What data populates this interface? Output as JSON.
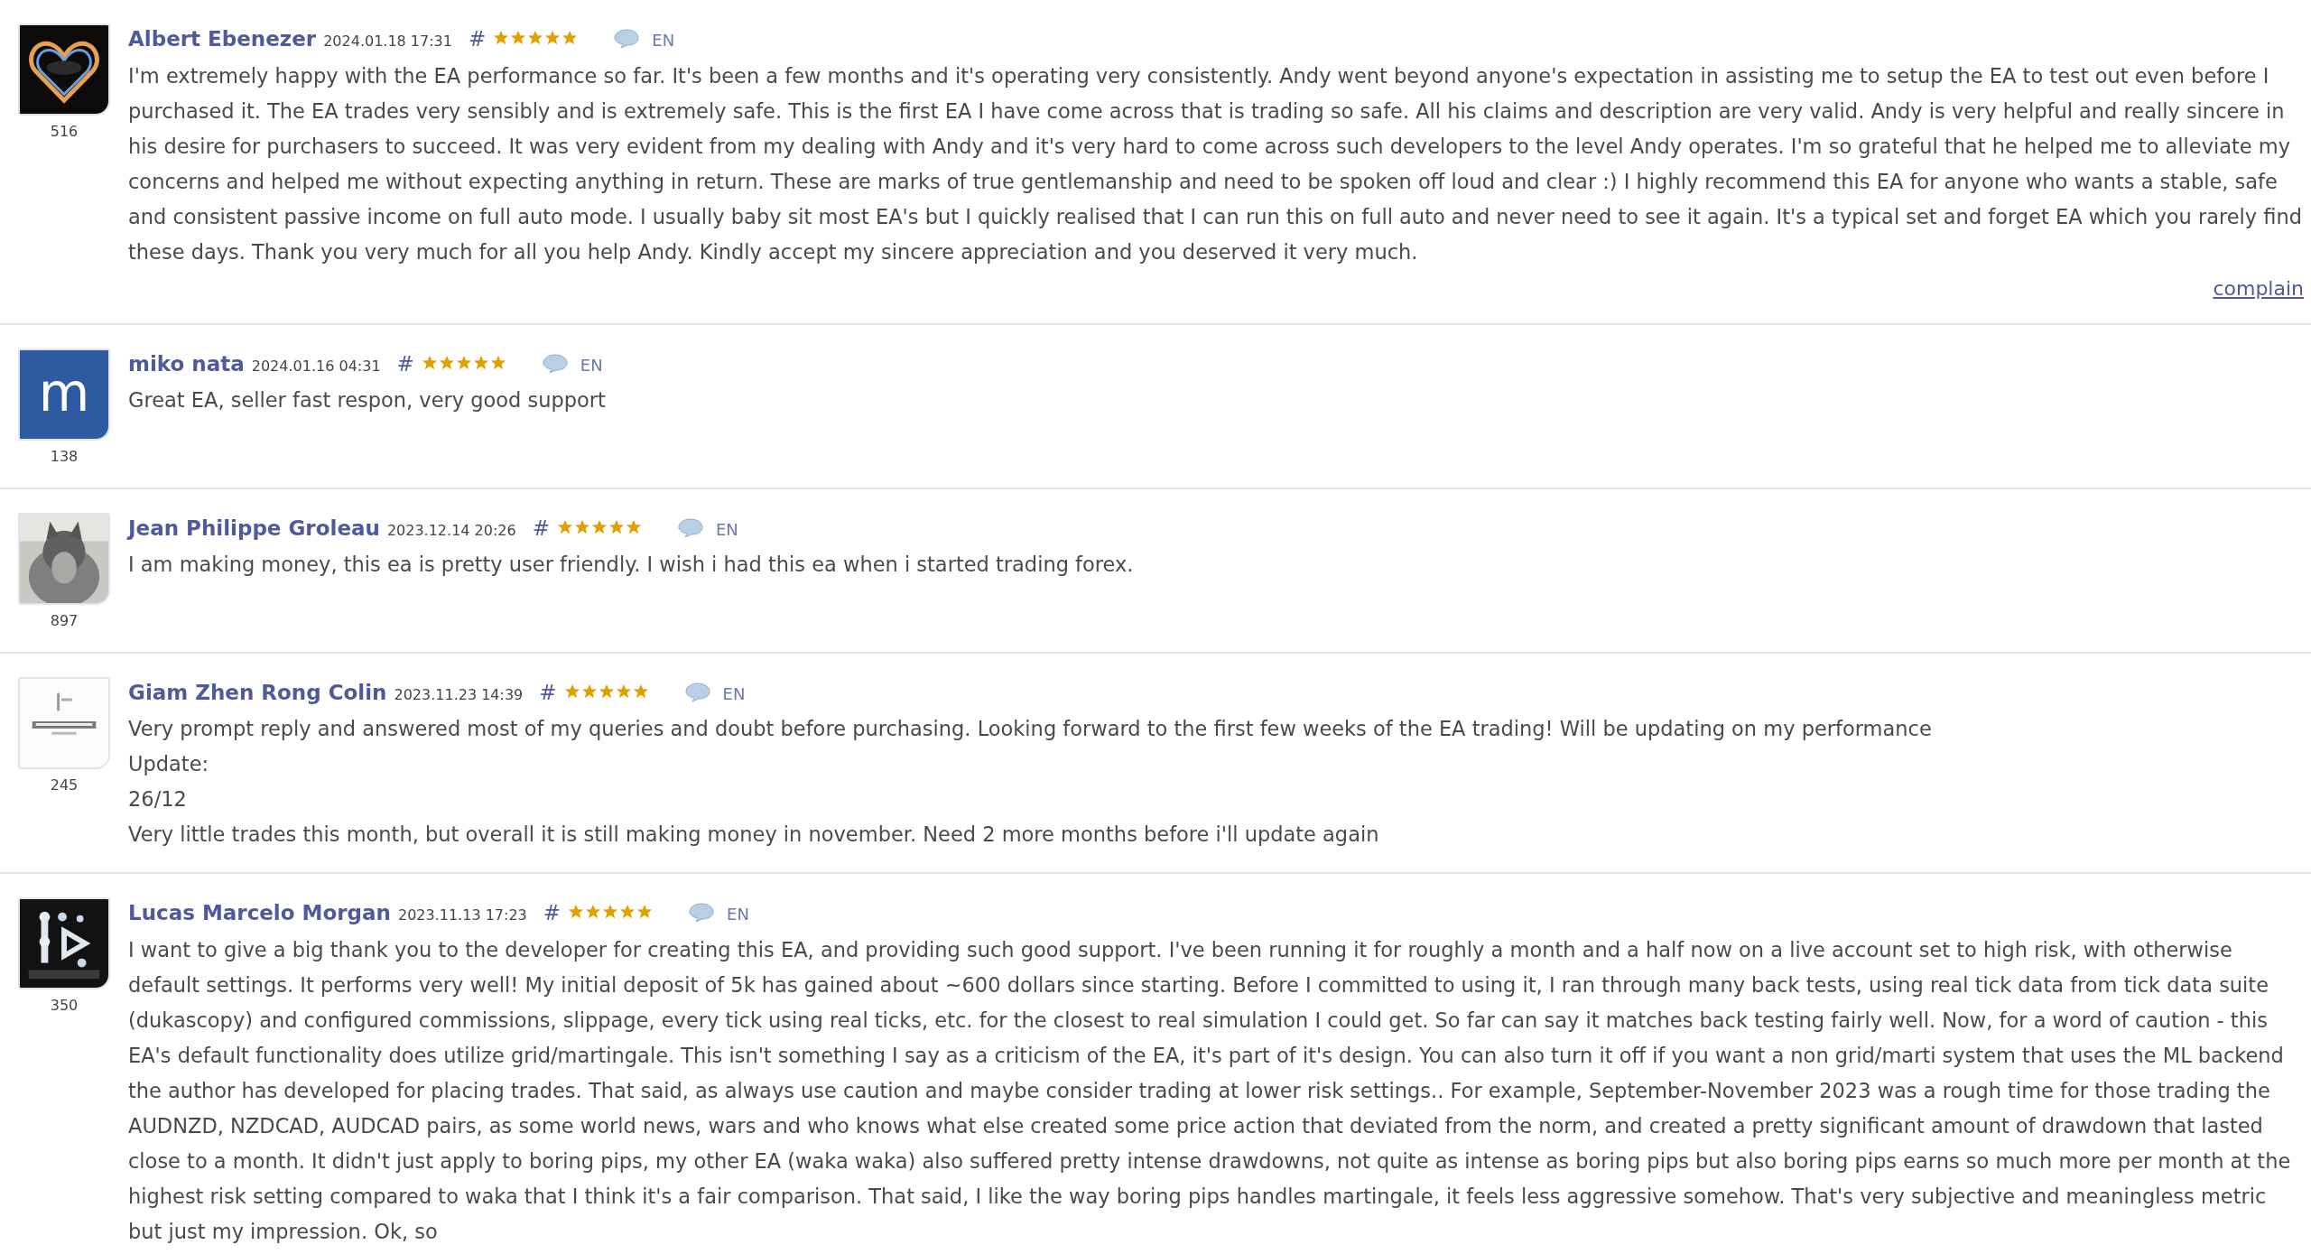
{
  "reviews": [
    {
      "author": "Albert Ebenezer",
      "date": "2024.01.18 17:31",
      "hash": "#",
      "stars": 5,
      "language": "EN",
      "avatar": {
        "kind": "picture"
      },
      "count": "516",
      "body": [
        "I'm extremely happy with the EA performance so far. It's been a few months and it's operating very consistently. Andy went beyond anyone's expectation in assisting me to setup the EA to test out even before I purchased it. The EA trades very sensibly and is extremely safe. This is the first EA I have come across that is trading so safe. All his claims and description are very valid. Andy is very helpful and really sincere in his desire for purchasers to succeed. It was very evident from my dealing with Andy and it's very hard to come across such developers to the level Andy operates. I'm so grateful that he helped me to alleviate my concerns and helped me without expecting anything in return. These are marks of true gentlemanship and need to be spoken off loud and clear :) I highly recommend this EA for anyone who wants a stable, safe and consistent passive income on full auto mode. I usually baby sit most EA's but I quickly realised that I can run this on full auto and never need to see it again. It's a typical set and forget EA which you rarely find these days. Thank you very much for all you help Andy. Kindly accept my sincere appreciation and you deserved it very much."
      ],
      "link": "complain"
    },
    {
      "author": "miko nata",
      "date": "2024.01.16 04:31",
      "hash": "#",
      "stars": 5,
      "language": "EN",
      "avatar": {
        "kind": "letter",
        "letter": "m"
      },
      "count": "138",
      "body": [
        "Great EA, seller fast respon, very good support"
      ]
    },
    {
      "author": "Jean Philippe Groleau",
      "date": "2023.12.14 20:26",
      "hash": "#",
      "stars": 5,
      "language": "EN",
      "avatar": {
        "kind": "picture"
      },
      "count": "897",
      "body": [
        "I am making money, this ea is pretty user friendly. I wish i had this ea when i started trading forex."
      ]
    },
    {
      "author": "Giam Zhen Rong Colin",
      "date": "2023.11.23 14:39",
      "hash": "#",
      "stars": 5,
      "language": "EN",
      "avatar": {
        "kind": "picture"
      },
      "count": "245",
      "body": [
        "Very prompt reply and answered most of my queries and doubt before purchasing. Looking forward to the first few weeks of the EA trading! Will be updating on my performance",
        "Update:",
        "26/12",
        "Very little trades this month, but overall it is still making money in november. Need 2 more months before i'll update again"
      ]
    },
    {
      "author": "Lucas Marcelo Morgan",
      "date": "2023.11.13 17:23",
      "hash": "#",
      "stars": 5,
      "language": "EN",
      "avatar": {
        "kind": "picture"
      },
      "count": "350",
      "body": [
        "I want to give a big thank you to the developer for creating this EA, and providing such good support. I've been running it for roughly a month and a half now on a live account set to high risk, with otherwise default settings. It performs very well! My initial deposit of 5k has gained about ~600 dollars since starting. Before I committed to using it, I ran through many back tests, using real tick data from tick data suite (dukascopy) and configured commissions, slippage, every tick using real ticks, etc. for the closest to real simulation I could get. So far can say it matches back testing fairly well. Now, for a word of caution - this EA's default functionality does utilize grid/martingale. This isn't something I say as a criticism of the EA, it's part of it's design. You can also turn it off if you want a non grid/marti system that uses the ML backend the author has developed for placing trades. That said, as always use caution and maybe consider trading at lower risk settings.. For example, September-November 2023 was a rough time for those trading the AUDNZD, NZDCAD, AUDCAD pairs, as some world news, wars and who knows what else created some price action that deviated from the norm, and created a pretty significant amount of drawdown that lasted close to a month. It didn't just apply to boring pips, my other EA (waka waka) also suffered pretty intense drawdowns, not quite as intense as boring pips but also boring pips earns so much more per month at the highest risk setting compared to waka that I think it's a fair comparison. That said, I like the way boring pips handles martingale, it feels less aggressive somehow. That's very subjective and meaningless metric but just my impression. Ok, so"
      ]
    }
  ]
}
